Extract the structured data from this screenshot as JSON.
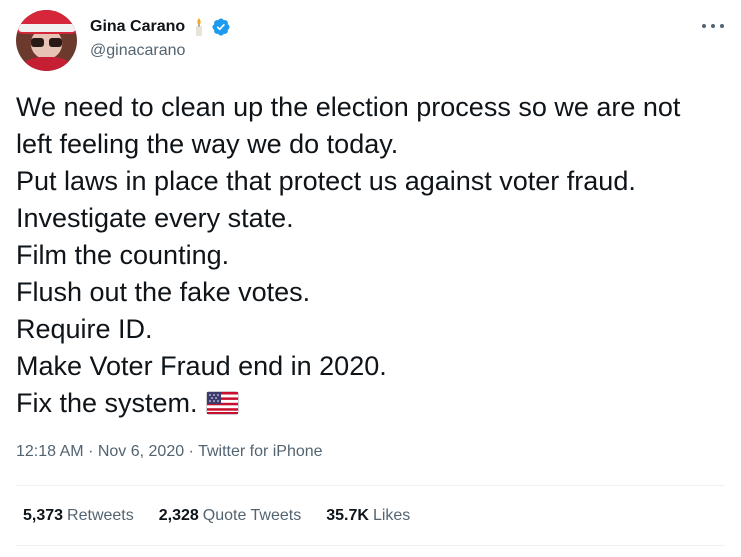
{
  "tweet": {
    "author": {
      "name": "Gina Carano",
      "handle": "@ginacarano",
      "verified": true
    },
    "lines": [
      "We need to clean up the election process so we are not",
      "left feeling the way we do today.",
      "Put laws in place that protect us against voter fraud.",
      "Investigate every state.",
      "Film the counting.",
      "Flush out the fake votes.",
      "Require ID.",
      "Make Voter Fraud end in 2020.",
      "Fix the system."
    ],
    "emoji": "us-flag-icon",
    "meta": {
      "time": "12:18 AM",
      "separator": "·",
      "date": "Nov 6, 2020",
      "source": "Twitter for iPhone"
    },
    "stats": [
      {
        "count": "5,373",
        "label": "Retweets"
      },
      {
        "count": "2,328",
        "label": "Quote Tweets"
      },
      {
        "count": "35.7K",
        "label": "Likes"
      }
    ]
  },
  "colors": {
    "text": "#0f1419",
    "secondary": "#536471",
    "verified": "#1d9bf0",
    "divider": "#eff3f4"
  }
}
